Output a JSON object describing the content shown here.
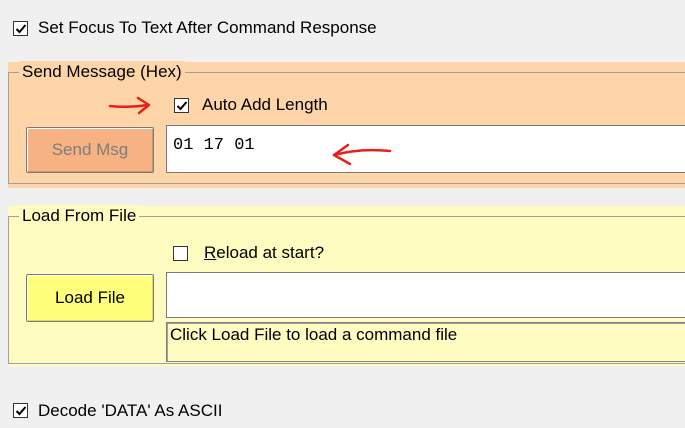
{
  "options": {
    "set_focus_label": "Set Focus To Text After Command Response",
    "set_focus_checked": true,
    "decode_ascii_label": "Decode 'DATA' As ASCII",
    "decode_ascii_checked": true
  },
  "send_message": {
    "group_label": "Send Message (Hex)",
    "auto_add_length_label": "Auto Add Length",
    "auto_add_length_checked": true,
    "send_button_label": "Send Msg",
    "send_button_enabled": false,
    "hex_value": "01 17 01"
  },
  "load_from_file": {
    "group_label": "Load From File",
    "reload_label_prefix": "R",
    "reload_label_rest": "eload at start?",
    "reload_checked": false,
    "load_button_label": "Load File",
    "file_path_value": "",
    "status_text": "Click Load File to load a command file"
  },
  "colors": {
    "send_panel_bg": "#fdd5a9",
    "load_panel_bg": "#fefcc0",
    "annotation_arrow": "#e8201c"
  }
}
